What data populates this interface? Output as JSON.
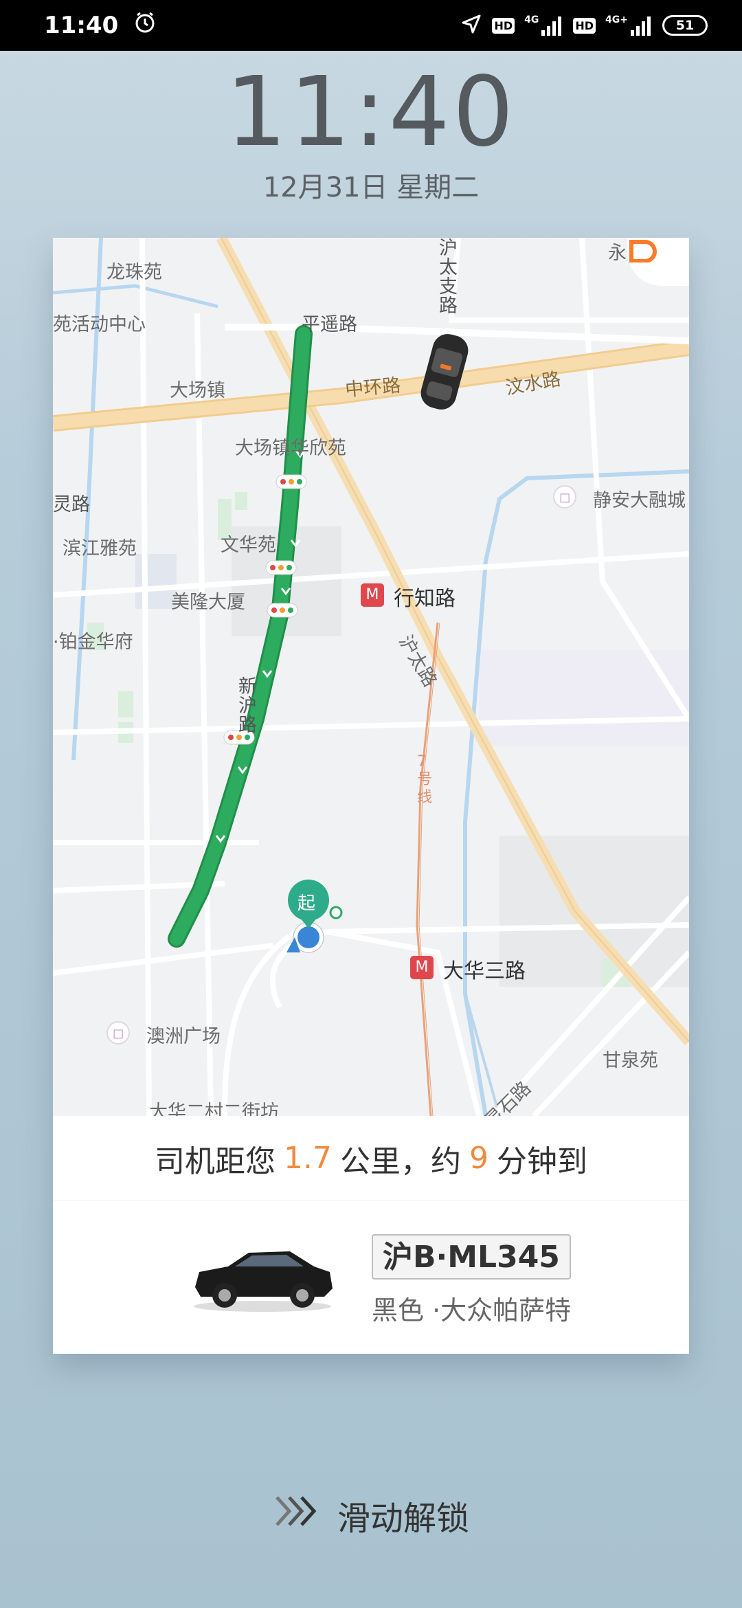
{
  "status_bar": {
    "time": "11:40",
    "net1": "4G",
    "net2": "4G+",
    "hd": "HD",
    "battery": "51"
  },
  "lock": {
    "clock": "11:40",
    "date": "12月31日 星期二"
  },
  "map": {
    "labels": {
      "longzhuyuan": "龙珠苑",
      "pingyaolu": "平遥路",
      "hutaizhilu": "沪太支路",
      "yong": "永",
      "huodong": "苑活动中心",
      "zhonghuanlu": "中环路",
      "wenshuilu": "汶水路",
      "dachangzhen": "大场镇",
      "xingzhilu": "行知路",
      "hutailu": "沪太路",
      "huaxinyuan": "大场镇华欣苑",
      "xinhulu": "新沪路",
      "linglu": "灵路",
      "jingan": "静安大融城",
      "line7": "7号线",
      "binjiang": "滨江雅苑",
      "wenhuayuan": "文华苑",
      "meilong": "美隆大厦",
      "bojin": "·铂金华府",
      "dahuasanlu": "大华三路",
      "aozhou": "澳洲广场",
      "ganquan": "甘泉苑",
      "lingshilu": "灵石路",
      "dahuaercun": "大华二村二街坊",
      "start": "起"
    }
  },
  "trip": {
    "eta_prefix": "司机距您",
    "distance": "1.7",
    "eta_mid": "公里，约",
    "minutes": "9",
    "eta_suffix": "分钟到",
    "plate": "沪B·ML345",
    "car_desc": "黑色 ·大众帕萨特"
  },
  "unlock": {
    "label": "滑动解锁"
  },
  "colors": {
    "route": "#2dab5f",
    "accent": "#f08a3c",
    "metro": "#e0474c",
    "didi": "#fc7b2b"
  }
}
